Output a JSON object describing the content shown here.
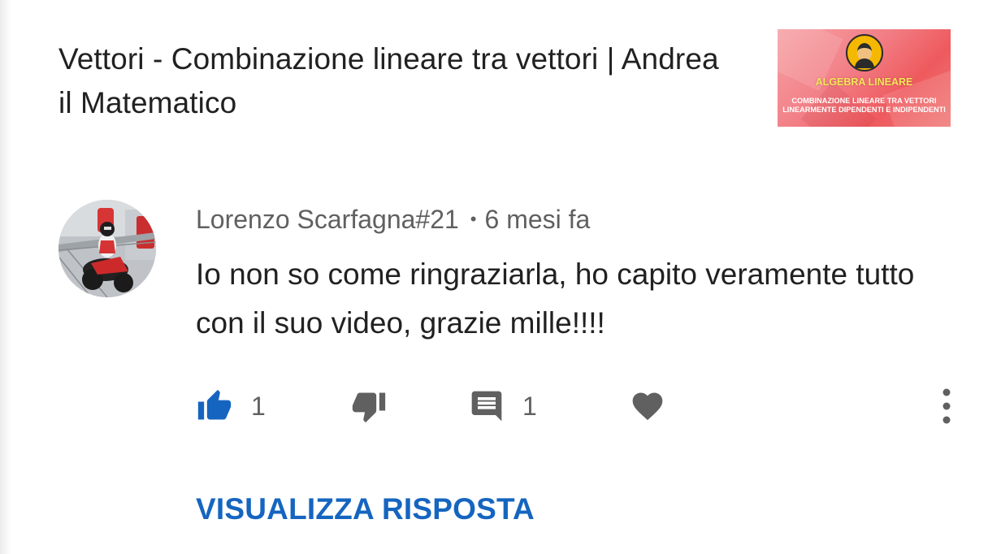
{
  "video": {
    "title": "Vettori - Combinazione lineare tra vettori | Andrea il Matematico",
    "thumbnail": {
      "heading": "ALGEBRA LINEARE",
      "subtitle": "COMBINAZIONE LINEARE TRA VETTORI LINEARMENTE DIPENDENTI E INDIPENDENTI",
      "logo_icon": "channel-logo",
      "colors": {
        "background": "#f28087",
        "heading": "#f4e65a"
      }
    }
  },
  "comment": {
    "author": "Lorenzo Scarfagna#21",
    "separator": "•",
    "time": "6 mesi fa",
    "text": "Io non so come ringraziarla, ho capito veramente tutto con il suo video, grazie mille!!!!",
    "avatar_icon": "user-avatar",
    "actions": {
      "like_icon": "thumbs-up-icon",
      "like_count": "1",
      "like_active": true,
      "dislike_icon": "thumbs-down-icon",
      "reply_icon": "comment-icon",
      "reply_count": "1",
      "heart_icon": "heart-icon",
      "more_icon": "more-vert-icon"
    },
    "view_reply_label": "VISUALIZZA RISPOSTA"
  },
  "colors": {
    "accent_blue": "#1565c0",
    "icon_gray": "#606060",
    "text_primary": "#212121",
    "text_secondary": "#606060"
  }
}
